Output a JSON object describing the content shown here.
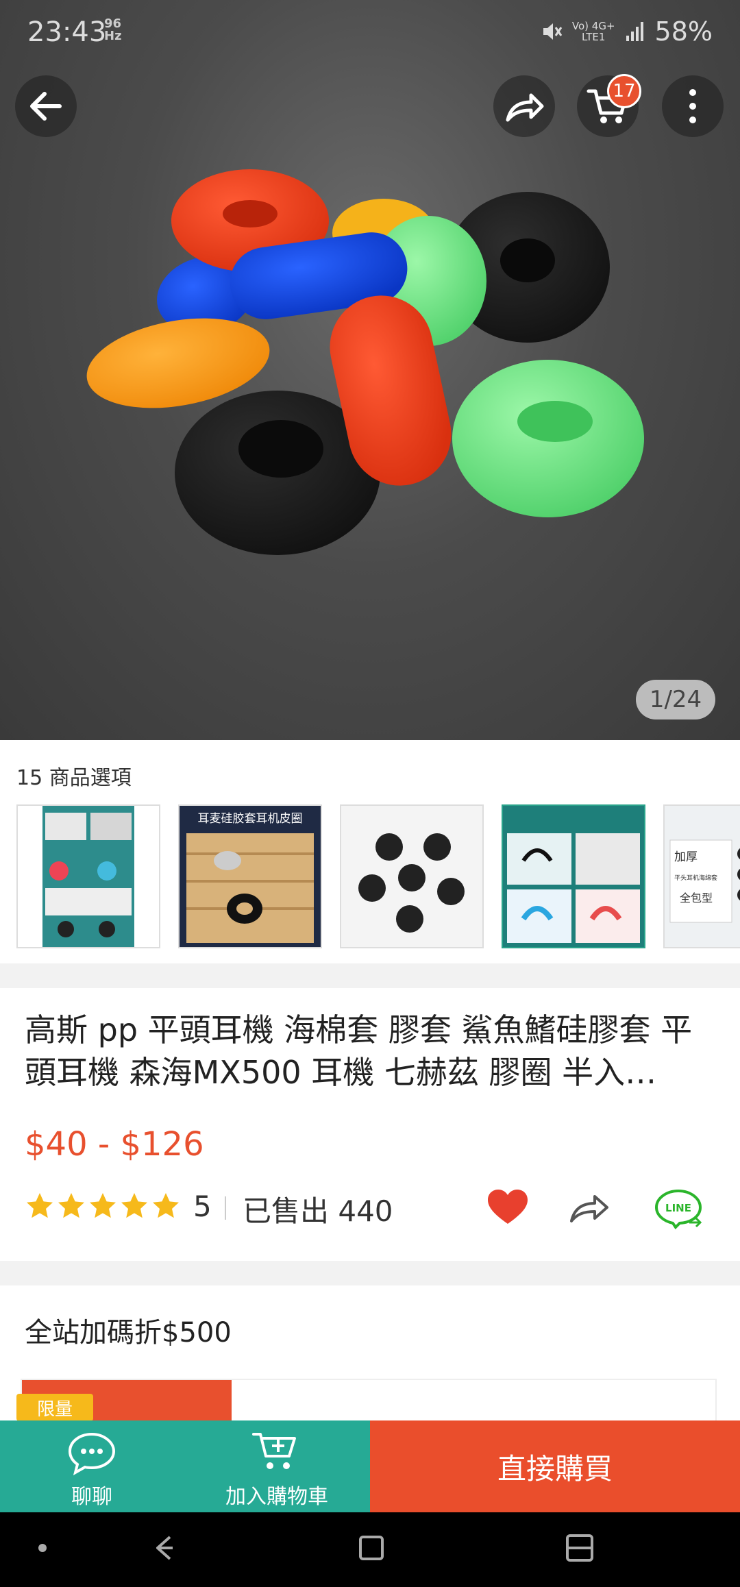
{
  "status_bar": {
    "time": "23:43",
    "refresh_rate": "96\nHz",
    "network_top": "Vo) 4G+",
    "network_bottom": "LTE1",
    "battery": "58%"
  },
  "cart": {
    "badge_count": "17"
  },
  "gallery": {
    "counter": "1/24"
  },
  "options": {
    "label": "15 商品選項"
  },
  "product": {
    "title": "高斯 pp 平頭耳機 海棉套 膠套  鯊魚鰭硅膠套 平頭耳機 森海MX500 耳機 七赫茲 膠圈  半入…",
    "price": "$40 - $126",
    "rating": "5",
    "rating_stars": 5,
    "sold": "已售出 440"
  },
  "promo": {
    "text": "全站加碼折$500",
    "tag": "限量"
  },
  "bottom_bar": {
    "chat_label": "聊聊",
    "add_cart_label": "加入購物車",
    "buy_label": "直接購買"
  },
  "thumb_texts": {
    "t2_title": "耳麦硅胶套耳机皮圈",
    "t5_line1": "加厚",
    "t5_line2": "平头耳机海绵套",
    "t5_line3": "全包型"
  },
  "colors": {
    "accent_green": "#26aa95",
    "accent_orange": "#ea4e2c",
    "star": "#f6b91b",
    "heart": "#e8402e"
  },
  "icons": [
    "back-arrow-icon",
    "share-icon",
    "cart-icon",
    "more-vertical-icon",
    "star-icon",
    "heart-icon",
    "share-outline-icon",
    "line-share-icon",
    "chat-bubble-icon",
    "add-cart-icon"
  ]
}
